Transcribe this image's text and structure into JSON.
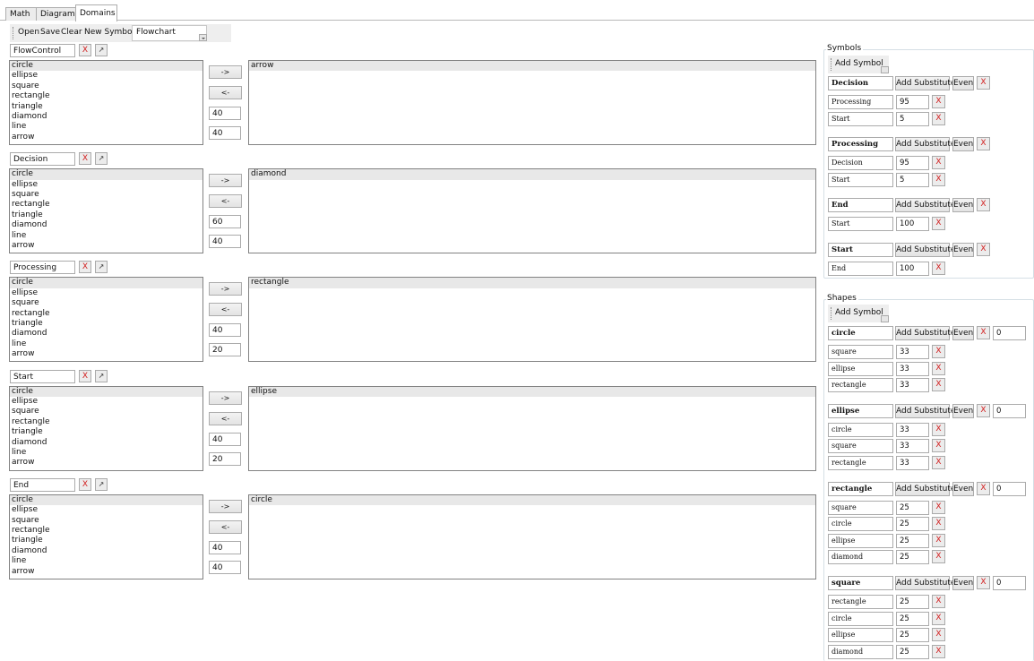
{
  "tabs": [
    {
      "label": "Math",
      "active": false
    },
    {
      "label": "Diagrams",
      "active": false
    },
    {
      "label": "Domains",
      "active": true
    }
  ],
  "toolbar": {
    "open_label": "Open",
    "save_label": "Save",
    "clear_label": "Clear",
    "new_symbol_label": "New Symbol",
    "domain_value": "Flowchart"
  },
  "common": {
    "x_label": "X",
    "edit_glyph": "↗",
    "add_right_label": "->",
    "remove_left_label": "<-",
    "add_symbol_label": "Add Symbol",
    "add_substitute_label": "Add Substitute",
    "even_label": "Even"
  },
  "rules": [
    {
      "name": "FlowControl",
      "available": [
        "circle",
        "ellipse",
        "square",
        "rectangle",
        "triangle",
        "diamond",
        "line",
        "arrow"
      ],
      "width": "40",
      "height": "40",
      "selected": [
        "arrow"
      ]
    },
    {
      "name": "Decision",
      "available": [
        "circle",
        "ellipse",
        "square",
        "rectangle",
        "triangle",
        "diamond",
        "line",
        "arrow"
      ],
      "width": "60",
      "height": "40",
      "selected": [
        "diamond"
      ]
    },
    {
      "name": "Processing",
      "available": [
        "circle",
        "ellipse",
        "square",
        "rectangle",
        "triangle",
        "diamond",
        "line",
        "arrow"
      ],
      "width": "40",
      "height": "20",
      "selected": [
        "rectangle"
      ]
    },
    {
      "name": "Start",
      "available": [
        "circle",
        "ellipse",
        "square",
        "rectangle",
        "triangle",
        "diamond",
        "line",
        "arrow"
      ],
      "width": "40",
      "height": "20",
      "selected": [
        "ellipse"
      ]
    },
    {
      "name": "End",
      "available": [
        "circle",
        "ellipse",
        "square",
        "rectangle",
        "triangle",
        "diamond",
        "line",
        "arrow"
      ],
      "width": "40",
      "height": "40",
      "selected": [
        "circle"
      ]
    }
  ],
  "symbols_panel": {
    "title": "Symbols",
    "groups": [
      {
        "name": "Decision",
        "subs": [
          {
            "name": "Processing",
            "value": "95"
          },
          {
            "name": "Start",
            "value": "5"
          }
        ]
      },
      {
        "name": "Processing",
        "subs": [
          {
            "name": "Decision",
            "value": "95"
          },
          {
            "name": "Start",
            "value": "5"
          }
        ]
      },
      {
        "name": "End",
        "subs": [
          {
            "name": "Start",
            "value": "100"
          }
        ]
      },
      {
        "name": "Start",
        "subs": [
          {
            "name": "End",
            "value": "100"
          }
        ]
      }
    ]
  },
  "shapes_panel": {
    "title": "Shapes",
    "groups": [
      {
        "name": "circle",
        "extra": "0",
        "subs": [
          {
            "name": "square",
            "value": "33"
          },
          {
            "name": "ellipse",
            "value": "33"
          },
          {
            "name": "rectangle",
            "value": "33"
          }
        ]
      },
      {
        "name": "ellipse",
        "extra": "0",
        "subs": [
          {
            "name": "circle",
            "value": "33"
          },
          {
            "name": "square",
            "value": "33"
          },
          {
            "name": "rectangle",
            "value": "33"
          }
        ]
      },
      {
        "name": "rectangle",
        "extra": "0",
        "subs": [
          {
            "name": "square",
            "value": "25"
          },
          {
            "name": "circle",
            "value": "25"
          },
          {
            "name": "ellipse",
            "value": "25"
          },
          {
            "name": "diamond",
            "value": "25"
          }
        ]
      },
      {
        "name": "square",
        "extra": "0",
        "subs": [
          {
            "name": "rectangle",
            "value": "25"
          },
          {
            "name": "circle",
            "value": "25"
          },
          {
            "name": "ellipse",
            "value": "25"
          },
          {
            "name": "diamond",
            "value": "25"
          }
        ]
      }
    ]
  }
}
